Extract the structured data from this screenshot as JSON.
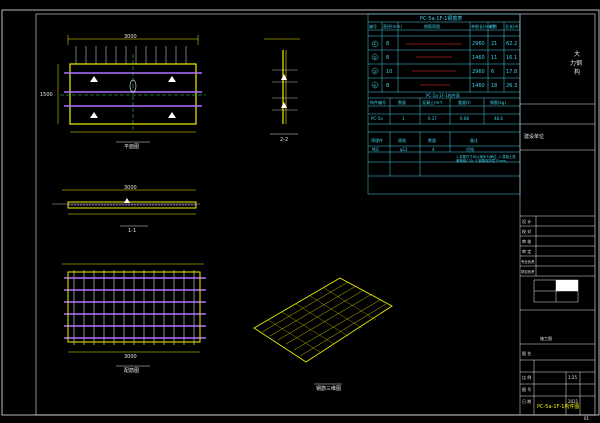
{
  "drawing": {
    "views": {
      "plan_top": "平面图",
      "elevation_side": "2-2",
      "elevation_front": "1-1",
      "plan_bottom": "配筋图",
      "axonometric": "钢筋三维图"
    },
    "dimensions": {
      "top_total": "3000",
      "front_total": "3000",
      "bottom_total": "3000",
      "left_depth": "1500"
    },
    "table1": {
      "title": "PC-5a-1F-1钢筋表",
      "headers": [
        "编号",
        "直径(mm)",
        "钢筋简图",
        "单根长(mm)",
        "根数",
        "总长(m)"
      ],
      "rows": [
        [
          "①",
          "8",
          "",
          "2960",
          "21",
          "62.2"
        ],
        [
          "②",
          "8",
          "",
          "1460",
          "11",
          "16.1"
        ],
        [
          "③",
          "10",
          "",
          "2960",
          "6",
          "17.8"
        ],
        [
          "④",
          "8",
          "",
          "1460",
          "18",
          "26.3"
        ]
      ]
    },
    "table2": {
      "title": "PC-5a-1F-1构件表",
      "headers": [
        "构件编号",
        "数量",
        "混凝土(m³)",
        "重量(t)",
        "钢筋(kg)"
      ],
      "rows": [
        [
          "PC-5a",
          "1",
          "0.27",
          "0.68",
          "48.6"
        ]
      ]
    },
    "table3": {
      "headers": [
        "预埋件",
        "规格",
        "数量",
        "备注"
      ],
      "rows": [
        [
          "MJ1",
          "φ12",
          "4",
          "吊钩"
        ]
      ],
      "notes": "1.本图尺寸均以毫米为单位; 2.混凝土强度等级C30; 3.钢筋保护层15mm。"
    },
    "title_block": {
      "company_top": "大",
      "company_sub": "力钢",
      "company_line3": "构",
      "project_label": "建设单位",
      "fields": [
        "设 计",
        "校 对",
        "审 核",
        "审 定",
        "专业负责",
        "项目负责"
      ],
      "design_phase": "施工图",
      "scale_label": "比 例",
      "scale_value": "1:25",
      "sheet_label": "图 号",
      "date_label": "日 期",
      "date_value": "2021",
      "sheet_no_label": "图 名",
      "drawing_name": "PC-5a-1F-1构件图",
      "page_no": "01"
    }
  }
}
